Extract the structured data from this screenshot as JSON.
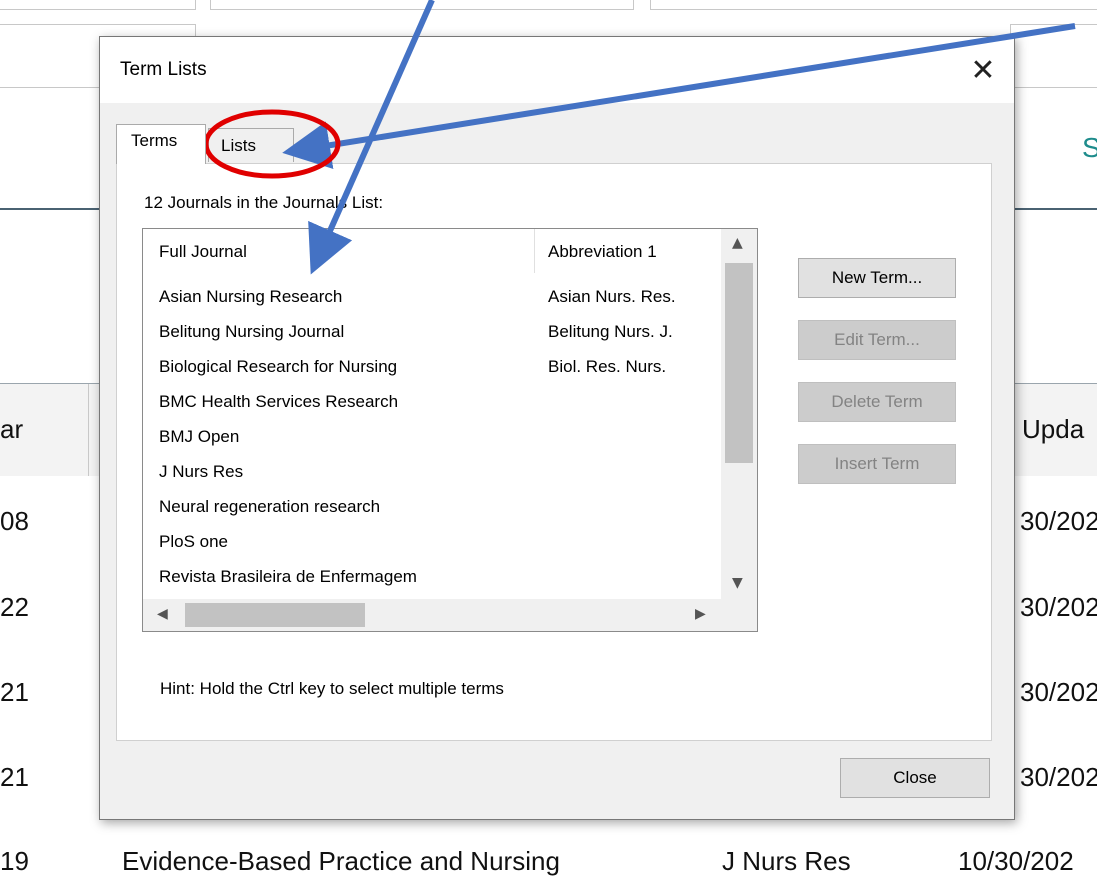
{
  "background": {
    "header_left": "ar",
    "header_right": "Upda",
    "right_partial": "S",
    "years": [
      "08",
      "22",
      "21",
      "21",
      "19"
    ],
    "dates": [
      "30/202",
      "30/202",
      "30/202",
      "30/202",
      "10/30/202"
    ],
    "last_row_title": "Evidence-Based Practice and Nursing",
    "last_row_abbr": "J Nurs Res"
  },
  "dialog": {
    "title": "Term Lists",
    "close_glyph": "✕",
    "tabs": [
      "Terms",
      "Lists"
    ],
    "count_label": "12 Journals in the Journals List:",
    "columns": [
      "Full Journal",
      "Abbreviation 1"
    ],
    "rows": [
      {
        "full": "Asian Nursing Research",
        "abbr": "Asian Nurs. Res."
      },
      {
        "full": "Belitung Nursing Journal",
        "abbr": "Belitung Nurs. J."
      },
      {
        "full": "Biological Research for Nursing",
        "abbr": "Biol. Res. Nurs."
      },
      {
        "full": "BMC Health Services Research",
        "abbr": ""
      },
      {
        "full": "BMJ Open",
        "abbr": ""
      },
      {
        "full": "J Nurs Res",
        "abbr": ""
      },
      {
        "full": "Neural regeneration research",
        "abbr": ""
      },
      {
        "full": "PloS one",
        "abbr": ""
      },
      {
        "full": "Revista Brasileira de Enfermagem",
        "abbr": ""
      }
    ],
    "buttons": {
      "new_term": "New Term...",
      "edit_term": "Edit Term...",
      "delete_term": "Delete Term",
      "insert_term": "Insert Term",
      "close": "Close"
    },
    "hint": "Hint: Hold the Ctrl key to select multiple terms"
  },
  "colors": {
    "annotation_arrow": "#4472c4",
    "annotation_circle": "#e00000",
    "accent_teal": "#1e8c8c"
  }
}
